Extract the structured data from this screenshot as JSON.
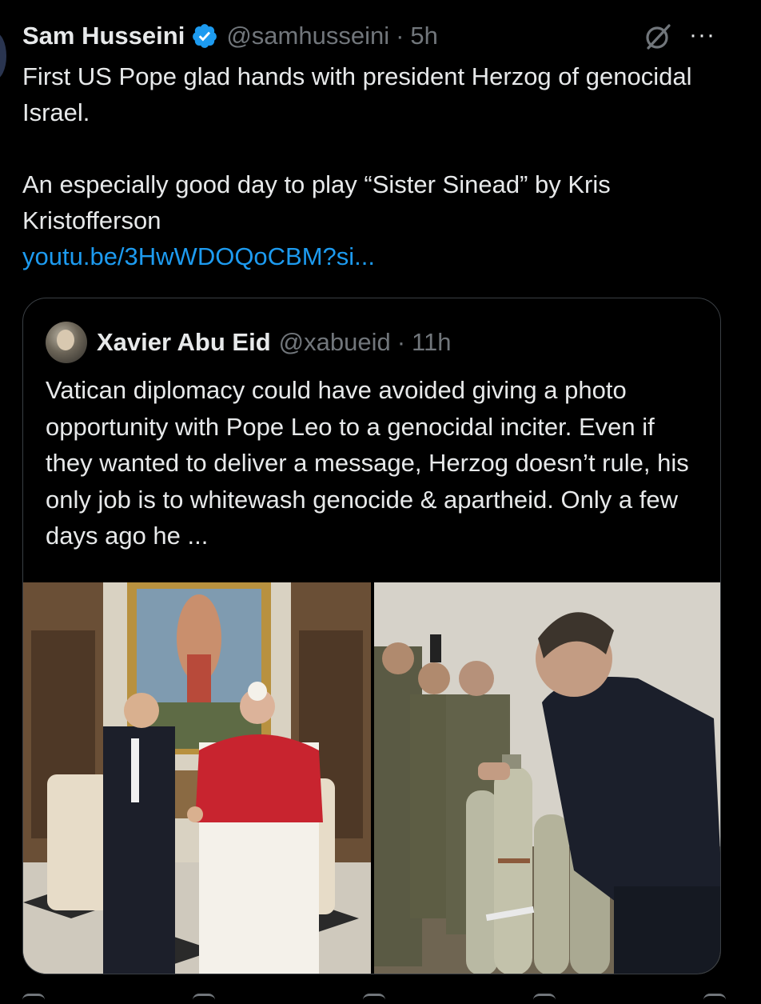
{
  "tweet": {
    "author_name": "Sam Husseini",
    "handle": "@samhusseini",
    "separator": "·",
    "time": "5h",
    "lines": [
      "First US Pope glad hands with president Herzog of genocidal Israel.",
      "An especially good day to play “Sister Sinead” by Kris Kristofferson"
    ],
    "link": "youtu.be/3HwWDOQoCBM?si...",
    "more_label": "···"
  },
  "quote": {
    "author_name": "Xavier Abu Eid",
    "handle": "@xabueid",
    "separator": "·",
    "time": "11h",
    "text": "Vatican diplomacy could have avoided giving a photo opportunity with Pope Leo to a genocidal inciter. Even if they wanted to deliver a message, Herzog doesn’t rule, his only job is to whitewash genocide & apartheid. Only a few days ago he ..."
  },
  "colors": {
    "background": "#000000",
    "text": "#e7e9ea",
    "muted": "#71767b",
    "link": "#1d9bf0",
    "verified": "#1d9bf0"
  }
}
